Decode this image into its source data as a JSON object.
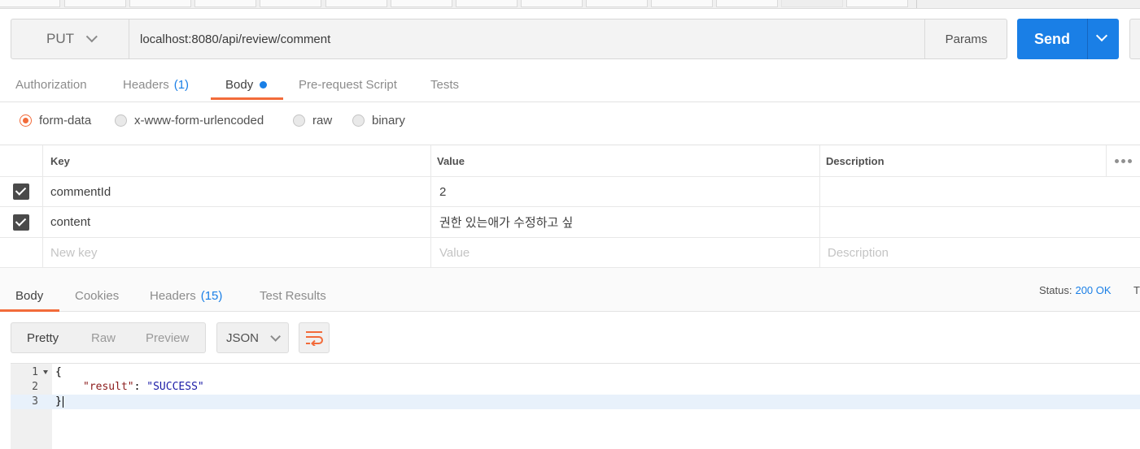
{
  "request": {
    "method": "PUT",
    "url": "localhost:8080/api/review/comment",
    "params_label": "Params",
    "send_label": "Send"
  },
  "request_tabs": [
    {
      "label": "Authorization",
      "count": ""
    },
    {
      "label": "Headers",
      "count": "(1)"
    },
    {
      "label": "Body",
      "count": ""
    },
    {
      "label": "Pre-request Script",
      "count": ""
    },
    {
      "label": "Tests",
      "count": ""
    }
  ],
  "body_types": [
    "form-data",
    "x-www-form-urlencoded",
    "raw",
    "binary"
  ],
  "selected_body_type": "form-data",
  "table": {
    "headers": {
      "key": "Key",
      "value": "Value",
      "description": "Description"
    },
    "rows": [
      {
        "checked": true,
        "key": "commentId",
        "value": "2",
        "description": ""
      },
      {
        "checked": true,
        "key": "content",
        "value": "권한 있는애가 수정하고 싶",
        "description": ""
      }
    ],
    "placeholders": {
      "key": "New key",
      "value": "Value",
      "description": "Description"
    }
  },
  "response_tabs": [
    {
      "label": "Body",
      "count": ""
    },
    {
      "label": "Cookies",
      "count": ""
    },
    {
      "label": "Headers",
      "count": "(15)"
    },
    {
      "label": "Test Results",
      "count": ""
    }
  ],
  "status": {
    "label": "Status:",
    "value": "200 OK",
    "time_label": "Ti"
  },
  "view_modes": [
    "Pretty",
    "Raw",
    "Preview"
  ],
  "format": "JSON",
  "code": {
    "line_numbers": [
      "1",
      "2",
      "3"
    ],
    "open_brace": "{",
    "key": "\"result\"",
    "colon": ": ",
    "value": "\"SUCCESS\"",
    "close_brace": "}"
  },
  "colors": {
    "accent": "#f26b3a",
    "primary": "#1a7fe6"
  }
}
